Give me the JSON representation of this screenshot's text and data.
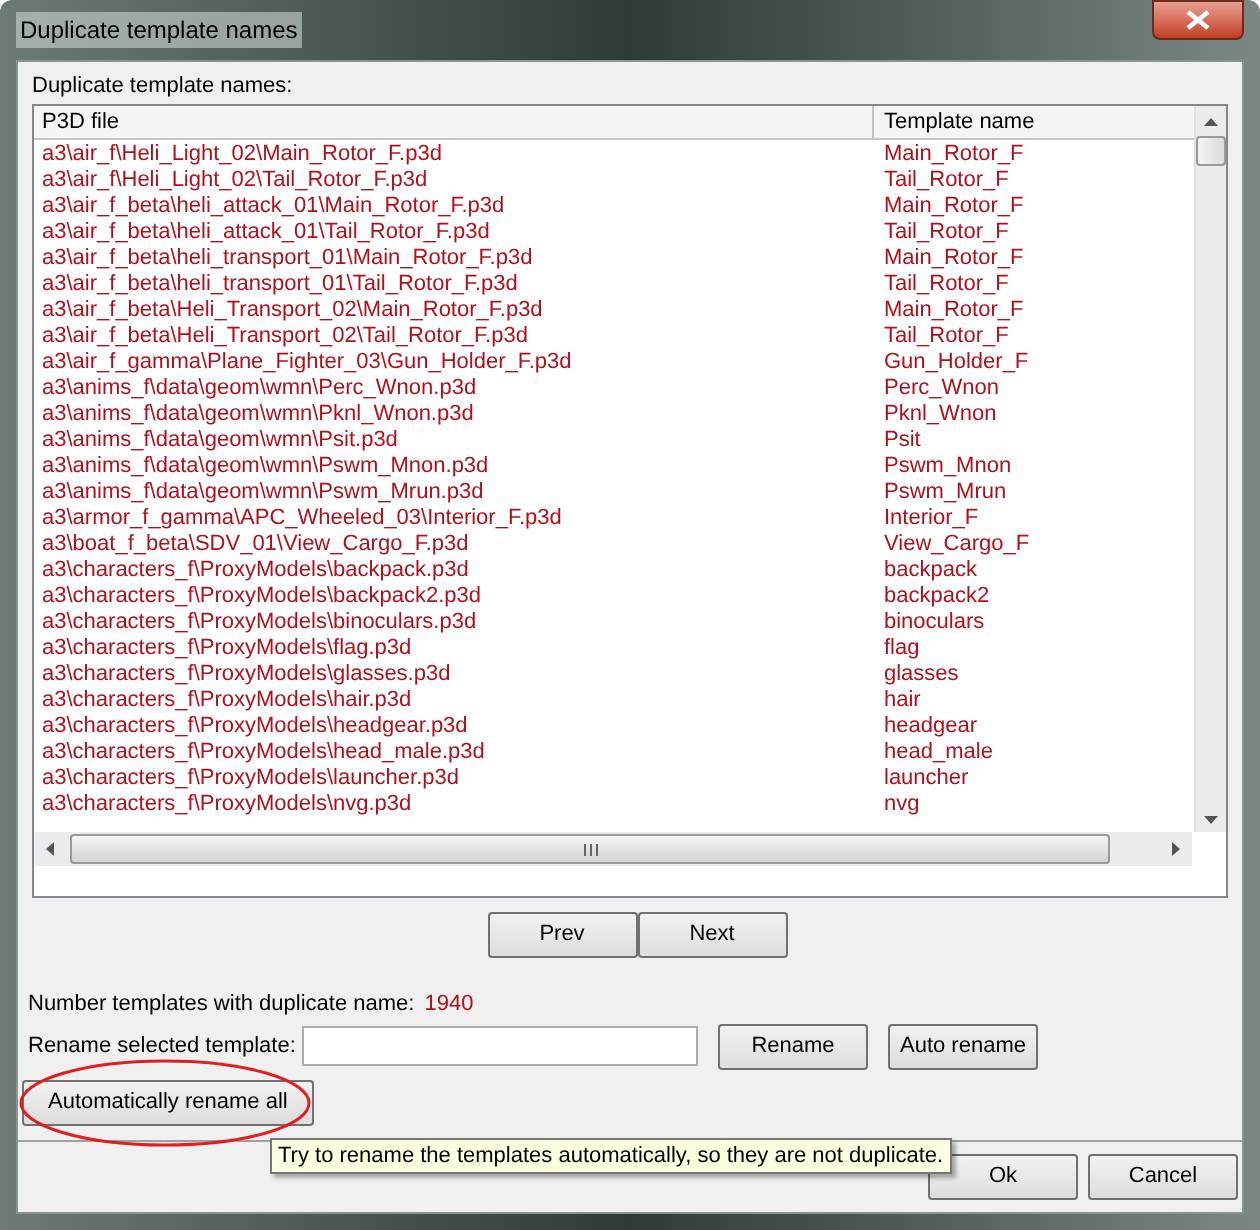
{
  "window": {
    "title": "Duplicate template names"
  },
  "list_label": "Duplicate template names:",
  "table": {
    "columns": [
      "P3D file",
      "Template name"
    ],
    "rows": [
      [
        "a3\\air_f\\Heli_Light_02\\Main_Rotor_F.p3d",
        "Main_Rotor_F"
      ],
      [
        "a3\\air_f\\Heli_Light_02\\Tail_Rotor_F.p3d",
        "Tail_Rotor_F"
      ],
      [
        "a3\\air_f_beta\\heli_attack_01\\Main_Rotor_F.p3d",
        "Main_Rotor_F"
      ],
      [
        "a3\\air_f_beta\\heli_attack_01\\Tail_Rotor_F.p3d",
        "Tail_Rotor_F"
      ],
      [
        "a3\\air_f_beta\\heli_transport_01\\Main_Rotor_F.p3d",
        "Main_Rotor_F"
      ],
      [
        "a3\\air_f_beta\\heli_transport_01\\Tail_Rotor_F.p3d",
        "Tail_Rotor_F"
      ],
      [
        "a3\\air_f_beta\\Heli_Transport_02\\Main_Rotor_F.p3d",
        "Main_Rotor_F"
      ],
      [
        "a3\\air_f_beta\\Heli_Transport_02\\Tail_Rotor_F.p3d",
        "Tail_Rotor_F"
      ],
      [
        "a3\\air_f_gamma\\Plane_Fighter_03\\Gun_Holder_F.p3d",
        "Gun_Holder_F"
      ],
      [
        "a3\\anims_f\\data\\geom\\wmn\\Perc_Wnon.p3d",
        "Perc_Wnon"
      ],
      [
        "a3\\anims_f\\data\\geom\\wmn\\Pknl_Wnon.p3d",
        "Pknl_Wnon"
      ],
      [
        "a3\\anims_f\\data\\geom\\wmn\\Psit.p3d",
        "Psit"
      ],
      [
        "a3\\anims_f\\data\\geom\\wmn\\Pswm_Mnon.p3d",
        "Pswm_Mnon"
      ],
      [
        "a3\\anims_f\\data\\geom\\wmn\\Pswm_Mrun.p3d",
        "Pswm_Mrun"
      ],
      [
        "a3\\armor_f_gamma\\APC_Wheeled_03\\Interior_F.p3d",
        "Interior_F"
      ],
      [
        "a3\\boat_f_beta\\SDV_01\\View_Cargo_F.p3d",
        "View_Cargo_F"
      ],
      [
        "a3\\characters_f\\ProxyModels\\backpack.p3d",
        "backpack"
      ],
      [
        "a3\\characters_f\\ProxyModels\\backpack2.p3d",
        "backpack2"
      ],
      [
        "a3\\characters_f\\ProxyModels\\binoculars.p3d",
        "binoculars"
      ],
      [
        "a3\\characters_f\\ProxyModels\\flag.p3d",
        "flag"
      ],
      [
        "a3\\characters_f\\ProxyModels\\glasses.p3d",
        "glasses"
      ],
      [
        "a3\\characters_f\\ProxyModels\\hair.p3d",
        "hair"
      ],
      [
        "a3\\characters_f\\ProxyModels\\headgear.p3d",
        "headgear"
      ],
      [
        "a3\\characters_f\\ProxyModels\\head_male.p3d",
        "head_male"
      ],
      [
        "a3\\characters_f\\ProxyModels\\launcher.p3d",
        "launcher"
      ],
      [
        "a3\\characters_f\\ProxyModels\\nvg.p3d",
        "nvg"
      ]
    ]
  },
  "pager": [
    "Prev",
    "Next"
  ],
  "count_label": "Number templates with duplicate name:",
  "count_value": "1940",
  "rename_label": "Rename selected template:",
  "rename_buttons": [
    "Rename",
    "Auto rename"
  ],
  "rename_all_button": {
    "label": "Automatically rename all",
    "circled": true
  },
  "tooltip": "Try to rename the templates automatically, so they are not duplicate.",
  "dialog_buttons": [
    "Ok",
    "Cancel"
  ]
}
